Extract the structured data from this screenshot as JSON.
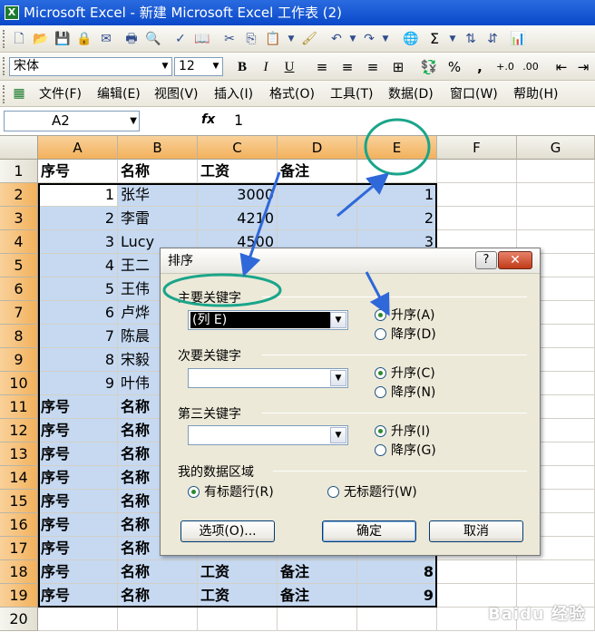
{
  "window": {
    "title": "Microsoft Excel - 新建 Microsoft Excel 工作表 (2)"
  },
  "toolbar": {
    "font_name": "宋体",
    "font_size": "12",
    "bold": "B",
    "italic": "I",
    "underline": "U",
    "percent": "%",
    "comma": ",",
    "sum": "Σ"
  },
  "menu": {
    "items": [
      "文件(F)",
      "编辑(E)",
      "视图(V)",
      "插入(I)",
      "格式(O)",
      "工具(T)",
      "数据(D)",
      "窗口(W)",
      "帮助(H)"
    ]
  },
  "formula_bar": {
    "name_box": "A2",
    "fx": "fx",
    "value": "1"
  },
  "sheet": {
    "columns": [
      "A",
      "B",
      "C",
      "D",
      "E",
      "F",
      "G"
    ],
    "row_numbers": [
      "1",
      "2",
      "3",
      "4",
      "5",
      "6",
      "7",
      "8",
      "9",
      "10",
      "11",
      "12",
      "13",
      "14",
      "15",
      "16",
      "17",
      "18",
      "19",
      "20"
    ],
    "header_row": [
      "序号",
      "名称",
      "工资",
      "备注",
      ""
    ],
    "data_rows": [
      [
        "1",
        "张华",
        "3000",
        "",
        "1"
      ],
      [
        "2",
        "李雷",
        "4210",
        "",
        "2"
      ],
      [
        "3",
        "Lucy",
        "4500",
        "",
        "3"
      ],
      [
        "4",
        "王二",
        "",
        "",
        ""
      ],
      [
        "5",
        "王伟",
        "",
        "",
        ""
      ],
      [
        "6",
        "卢烨",
        "",
        "",
        ""
      ],
      [
        "7",
        "陈晨",
        "",
        "",
        ""
      ],
      [
        "8",
        "宋毅",
        "",
        "",
        ""
      ],
      [
        "9",
        "叶伟",
        "",
        "",
        ""
      ],
      [
        "序号",
        "名称",
        "",
        "",
        ""
      ],
      [
        "序号",
        "名称",
        "",
        "",
        ""
      ],
      [
        "序号",
        "名称",
        "",
        "",
        ""
      ],
      [
        "序号",
        "名称",
        "",
        "",
        ""
      ],
      [
        "序号",
        "名称",
        "",
        "",
        ""
      ],
      [
        "序号",
        "名称",
        "",
        "",
        ""
      ],
      [
        "序号",
        "名称",
        "",
        "",
        ""
      ],
      [
        "序号",
        "名称",
        "工资",
        "备注",
        "8"
      ],
      [
        "序号",
        "名称",
        "工资",
        "备注",
        "9"
      ]
    ]
  },
  "sort_dialog": {
    "title": "排序",
    "help": "?",
    "close": "✕",
    "primary_key_label": "主要关键字",
    "primary_key_value": "(列 E)",
    "secondary_key_label": "次要关键字",
    "tertiary_key_label": "第三关键字",
    "asc1": "升序(A)",
    "desc1": "降序(D)",
    "asc2": "升序(C)",
    "desc2": "降序(N)",
    "asc3": "升序(I)",
    "desc3": "降序(G)",
    "range_label": "我的数据区域",
    "has_header": "有标题行(R)",
    "no_header": "无标题行(W)",
    "options_button": "选项(O)...",
    "ok_button": "确定",
    "cancel_button": "取消"
  },
  "annotations": {
    "color": "#1aa58a",
    "arrow_color": "#2f68d8"
  },
  "watermark": {
    "text": "Baidu 经验"
  }
}
